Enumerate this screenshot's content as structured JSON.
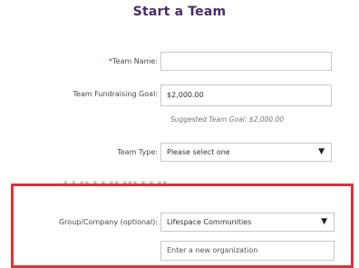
{
  "page": {
    "title": "Start a Team"
  },
  "form": {
    "team_name": {
      "required_mark": "*",
      "label": "Team Name:",
      "value": ""
    },
    "goal": {
      "label": "Team Fundraising Goal:",
      "value": "$2,000.00",
      "hint": "Suggested Team Goal: $2,000.00"
    },
    "team_type": {
      "label": "Team Type:",
      "selected": "Please select one"
    },
    "group_company": {
      "label": "Group/Company (optional):",
      "selected": "Lifespace Communities"
    },
    "new_org": {
      "placeholder": "Enter a new organization"
    }
  },
  "colors": {
    "title": "#4b2c6b",
    "required": "#cc1f2d",
    "highlight_border": "#d1373b"
  },
  "icons": {
    "select_arrow": "caret-down-icon"
  }
}
